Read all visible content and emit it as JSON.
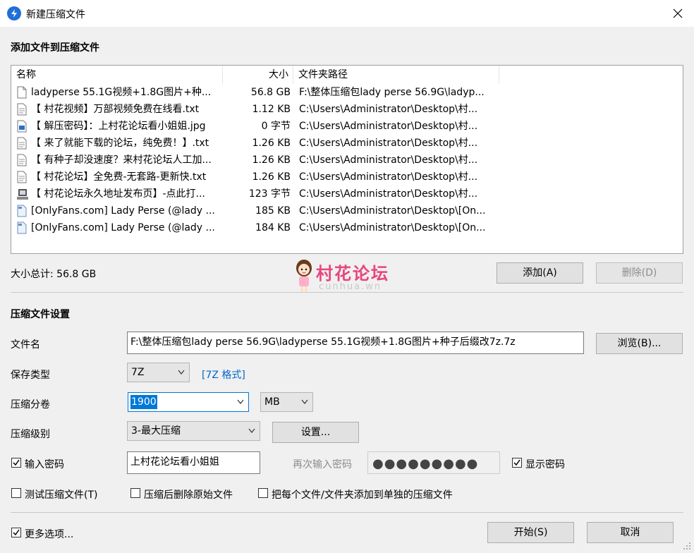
{
  "window": {
    "title": "新建压缩文件",
    "close_icon": "close-icon"
  },
  "add_section": {
    "heading": "添加文件到压缩文件"
  },
  "file_list": {
    "columns": [
      "名称",
      "大小",
      "文件夹路径"
    ],
    "rows": [
      {
        "icon": "document-icon",
        "name": "ladyperse 55.1G视频+1.8G图片+种...",
        "size": "56.8 GB",
        "path": "F:\\整体压缩包lady perse 56.9G\\ladyp..."
      },
      {
        "icon": "text-file-icon",
        "name": "【 村花视频】万部视频免费在线看.txt",
        "size": "1.12 KB",
        "path": "C:\\Users\\Administrator\\Desktop\\村..."
      },
      {
        "icon": "image-file-icon",
        "name": "【 解压密码】：上村花论坛看小姐姐.jpg",
        "size": "0 字节",
        "path": "C:\\Users\\Administrator\\Desktop\\村..."
      },
      {
        "icon": "text-file-icon",
        "name": "【 来了就能下载的论坛，纯免费！】.txt",
        "size": "1.26 KB",
        "path": "C:\\Users\\Administrator\\Desktop\\村..."
      },
      {
        "icon": "text-file-icon",
        "name": "【 有种子却没速度？来村花论坛人工加...",
        "size": "1.26 KB",
        "path": "C:\\Users\\Administrator\\Desktop\\村..."
      },
      {
        "icon": "text-file-icon",
        "name": "【 村花论坛】全免费-无套路-更新快.txt",
        "size": "1.26 KB",
        "path": "C:\\Users\\Administrator\\Desktop\\村..."
      },
      {
        "icon": "shortcut-file-icon",
        "name": "【 村花论坛永久地址发布页】-点此打...",
        "size": "123 字节",
        "path": "C:\\Users\\Administrator\\Desktop\\村..."
      },
      {
        "icon": "torrent-file-icon",
        "name": "[OnlyFans.com] Lady Perse (@lady ...",
        "size": "185 KB",
        "path": "C:\\Users\\Administrator\\Desktop\\[On..."
      },
      {
        "icon": "torrent-file-icon",
        "name": "[OnlyFans.com] Lady Perse (@lady ...",
        "size": "184 KB",
        "path": "C:\\Users\\Administrator\\Desktop\\[On..."
      }
    ]
  },
  "total_size": "大小总计: 56.8 GB",
  "buttons": {
    "add": "添加(A)",
    "delete": "删除(D)",
    "browse": "浏览(B)...",
    "settings": "设置...",
    "start": "开始(S)",
    "cancel": "取消"
  },
  "watermark": {
    "title": "村花论坛",
    "subtitle": "cunhua.wn"
  },
  "settings_section": {
    "heading": "压缩文件设置"
  },
  "fields": {
    "filename_label": "文件名",
    "filename_value": "F:\\整体压缩包lady perse 56.9G\\ladyperse 55.1G视频+1.8G图片+种子后缀改7z.7z",
    "save_type_label": "保存类型",
    "save_type_value": "7Z",
    "format_link": "[7Z 格式]",
    "volume_label": "压缩分卷",
    "volume_value": "1900",
    "volume_unit": "MB",
    "level_label": "压缩级别",
    "level_value": "3-最大压缩",
    "password_label": "输入密码",
    "password_value": "上村花论坛看小姐姐",
    "password_confirm_label": "再次输入密码",
    "password_confirm_dots": "●●●●●●●●●",
    "show_password_label": "显示密码"
  },
  "options": {
    "test_archive": "测试压缩文件(T)",
    "delete_after": "压缩后删除原始文件",
    "separate_archives": "把每个文件/文件夹添加到单独的压缩文件",
    "more_options": "更多选项..."
  },
  "checked": {
    "password": true,
    "show_password": true,
    "test_archive": false,
    "delete_after": false,
    "separate_archives": false,
    "more_options": true
  }
}
